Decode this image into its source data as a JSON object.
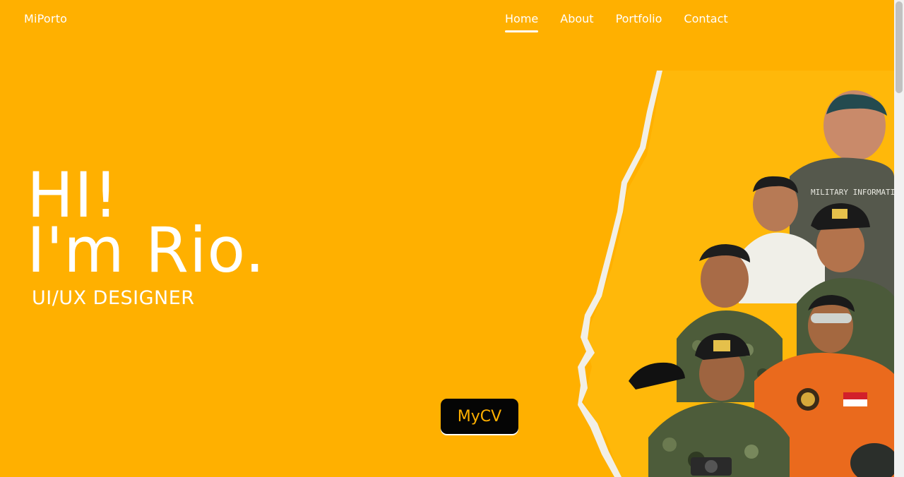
{
  "brand": "MiPorto",
  "nav": {
    "items": [
      {
        "label": "Home",
        "active": true
      },
      {
        "label": "About",
        "active": false
      },
      {
        "label": "Portfolio",
        "active": false
      },
      {
        "label": "Contact",
        "active": false
      }
    ]
  },
  "hero": {
    "line1": "HI!",
    "line2": "I'm Rio.",
    "subtitle": "UI/UX DESIGNER",
    "cta": "MyCV"
  },
  "photo": {
    "patch_text": "MILITARY INFORMATICS"
  },
  "colors": {
    "background": "#ffb000",
    "text": "#ffffff",
    "button_bg": "#050505",
    "button_text": "#ffb000"
  }
}
